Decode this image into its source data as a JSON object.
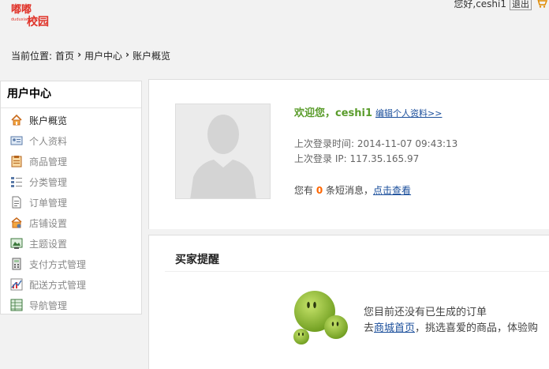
{
  "header": {
    "logo_alt": "嘟嘟校园",
    "greeting": "您好,ceshi1",
    "logout_label": "退出"
  },
  "breadcrumb": {
    "prefix": "当前位置:",
    "items": [
      "首页",
      "用户中心",
      "账户概览"
    ]
  },
  "sidebar": {
    "title": "用户中心",
    "items": [
      {
        "label": "账户概览",
        "icon": "home-icon",
        "active": true
      },
      {
        "label": "个人资料",
        "icon": "id-card-icon"
      },
      {
        "label": "商品管理",
        "icon": "clipboard-icon"
      },
      {
        "label": "分类管理",
        "icon": "list-icon"
      },
      {
        "label": "订单管理",
        "icon": "document-icon"
      },
      {
        "label": "店铺设置",
        "icon": "shop-icon"
      },
      {
        "label": "主题设置",
        "icon": "theme-icon"
      },
      {
        "label": "支付方式管理",
        "icon": "calculator-icon"
      },
      {
        "label": "配送方式管理",
        "icon": "chart-icon"
      },
      {
        "label": "导航管理",
        "icon": "grid-icon"
      }
    ]
  },
  "profile": {
    "welcome": "欢迎您，ceshi1",
    "edit_link": "编辑个人资料>>",
    "last_login_time": "上次登录时间: 2014-11-07 09:43:13",
    "last_login_ip": "上次登录 IP: 117.35.165.97",
    "msg_prefix": "您有",
    "msg_count": "0",
    "msg_suffix": "条短消息，",
    "msg_link": "点击查看"
  },
  "buyer": {
    "title": "买家提醒",
    "empty_line1": "您目前还没有已生成的订单",
    "empty_prefix": "去",
    "empty_link": "商城首页",
    "empty_suffix": "，挑选喜爱的商品，体验购"
  },
  "colors": {
    "accent_green": "#5a9c2b",
    "link_blue": "#1a4e9b",
    "count_orange": "#ff6600",
    "logo_red": "#e0342a"
  }
}
